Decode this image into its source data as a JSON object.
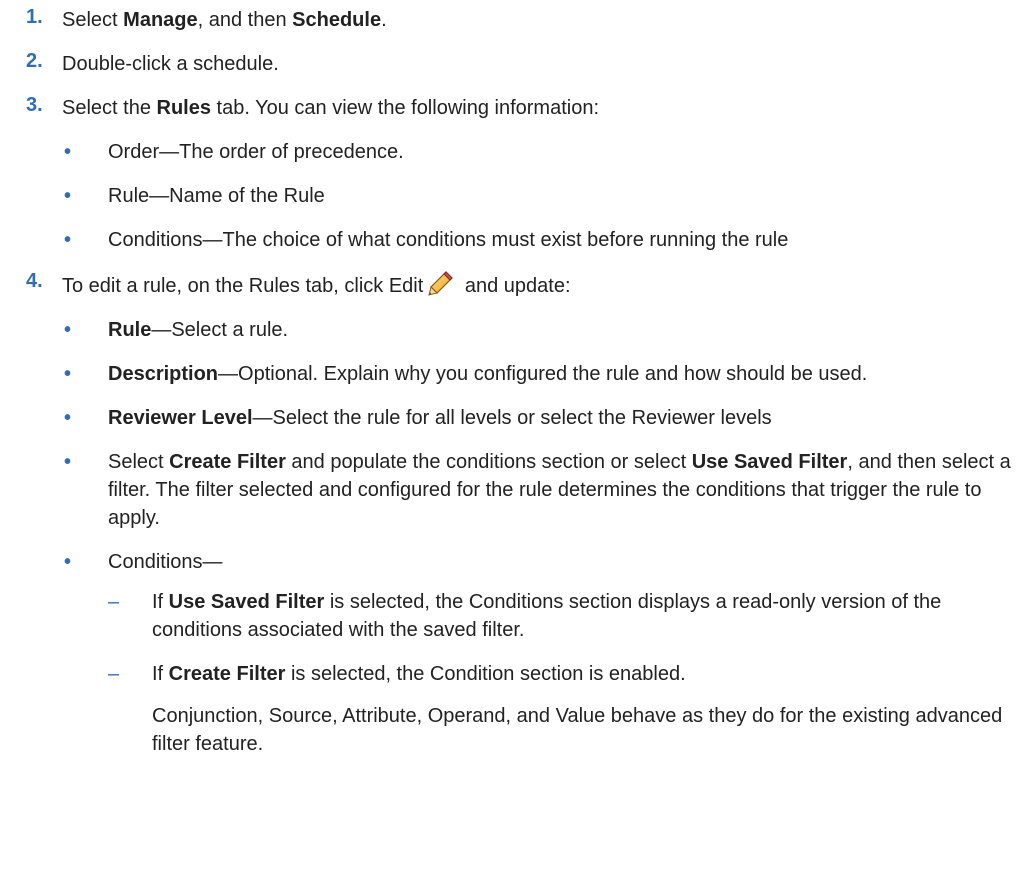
{
  "steps": [
    {
      "number": "1.",
      "parts": [
        "Select ",
        "Manage",
        ", and then ",
        "Schedule",
        "."
      ]
    },
    {
      "number": "2.",
      "text": "Double-click a schedule."
    },
    {
      "number": "3.",
      "parts": [
        "Select the ",
        "Rules",
        " tab. You can view the following information:"
      ],
      "bullets": [
        "Order—The order of precedence.",
        "Rule—Name of the Rule",
        "Conditions—The choice of what conditions must exist before running the rule"
      ]
    },
    {
      "number": "4.",
      "intro_before_icon": "To edit a rule, on the Rules tab, click Edit",
      "icon": "pencil-edit-icon",
      "intro_after_icon": " and update:",
      "bullets": [
        {
          "bold": "Rule",
          "text": "—Select a rule."
        },
        {
          "bold": "Description",
          "text": "—Optional. Explain why you configured the rule and how should be used."
        },
        {
          "bold": "Reviewer Level",
          "text": "—Select the rule for all levels or select the Reviewer levels"
        },
        {
          "p1": "Select ",
          "b1": "Create Filter",
          "p2": " and populate the conditions section or select ",
          "b2": "Use Saved Filter",
          "p3": ", and then select a filter. The filter selected and configured for the rule determines the conditions that trigger the rule to apply."
        },
        {
          "text": "Conditions—",
          "subs": [
            {
              "pre": "If ",
              "bold": "Use Saved Filter",
              "post": " is selected, the Conditions section displays a read-only version of the conditions associated with the saved filter."
            },
            {
              "pre": "If ",
              "bold": "Create Filter",
              "post": " is selected, the Condition section is enabled.",
              "para": "Conjunction, Source, Attribute, Operand, and Value behave as they do for the existing advanced filter feature."
            }
          ]
        }
      ]
    }
  ],
  "marks": {
    "bullet": "•",
    "dash": "–"
  },
  "colors": {
    "accent": "#2f6db5",
    "text": "#222222"
  }
}
